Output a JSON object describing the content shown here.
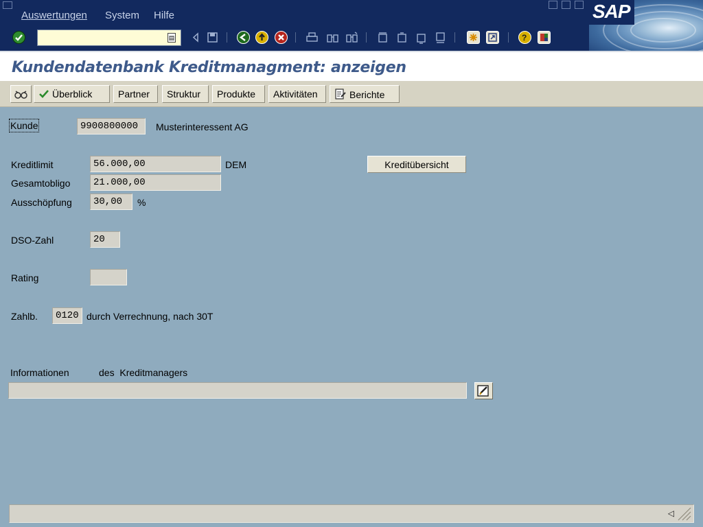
{
  "menu": {
    "items": [
      "Auswertungen",
      "System",
      "Hilfe"
    ],
    "logo_text": "SAP"
  },
  "toolbar": {
    "command_value": "",
    "icons": [
      "enter-icon",
      "back-icon",
      "save-icon",
      "green-back-icon",
      "exit-icon",
      "cancel-icon",
      "print-icon",
      "find-icon",
      "find-next-icon",
      "first-page-icon",
      "previous-page-icon",
      "next-page-icon",
      "last-page-icon",
      "create-session-icon",
      "shortcut-icon",
      "help-icon",
      "customize-layout-icon"
    ]
  },
  "title": "Kundendatenbank Kreditmanagment: anzeigen",
  "app_toolbar": {
    "buttons": [
      "Überblick",
      "Partner",
      "Struktur",
      "Produkte",
      "Aktivitäten",
      "Berichte"
    ]
  },
  "form": {
    "kunde": {
      "label": "Kunde",
      "value": "9900800000",
      "name": "Musterinteressent AG"
    },
    "kreditlimit": {
      "label": "Kreditlimit",
      "value": "56.000,00",
      "currency": "DEM"
    },
    "gesamtobligo": {
      "label": "Gesamtobligo",
      "value": "21.000,00"
    },
    "ausschoepfung": {
      "label": "Ausschöpfung",
      "value": "30,00",
      "unit": "%"
    },
    "dso": {
      "label": "DSO-Zahl",
      "value": "20"
    },
    "rating": {
      "label": "Rating",
      "value": ""
    },
    "zahlb": {
      "label": "Zahlb.",
      "value": "0120",
      "text": "durch Verrechnung, nach 30T"
    },
    "kredit_button": "Kreditübersicht",
    "info_label_1": "Informationen",
    "info_label_2": "des  Kreditmanagers",
    "info_value": ""
  },
  "status": {
    "text": ""
  },
  "colors": {
    "menubar": "#12295e",
    "background": "#8fabbe",
    "title": "#3e5a8a",
    "app_toolbar": "#d6d3c3",
    "field": "#d5d3ca"
  }
}
